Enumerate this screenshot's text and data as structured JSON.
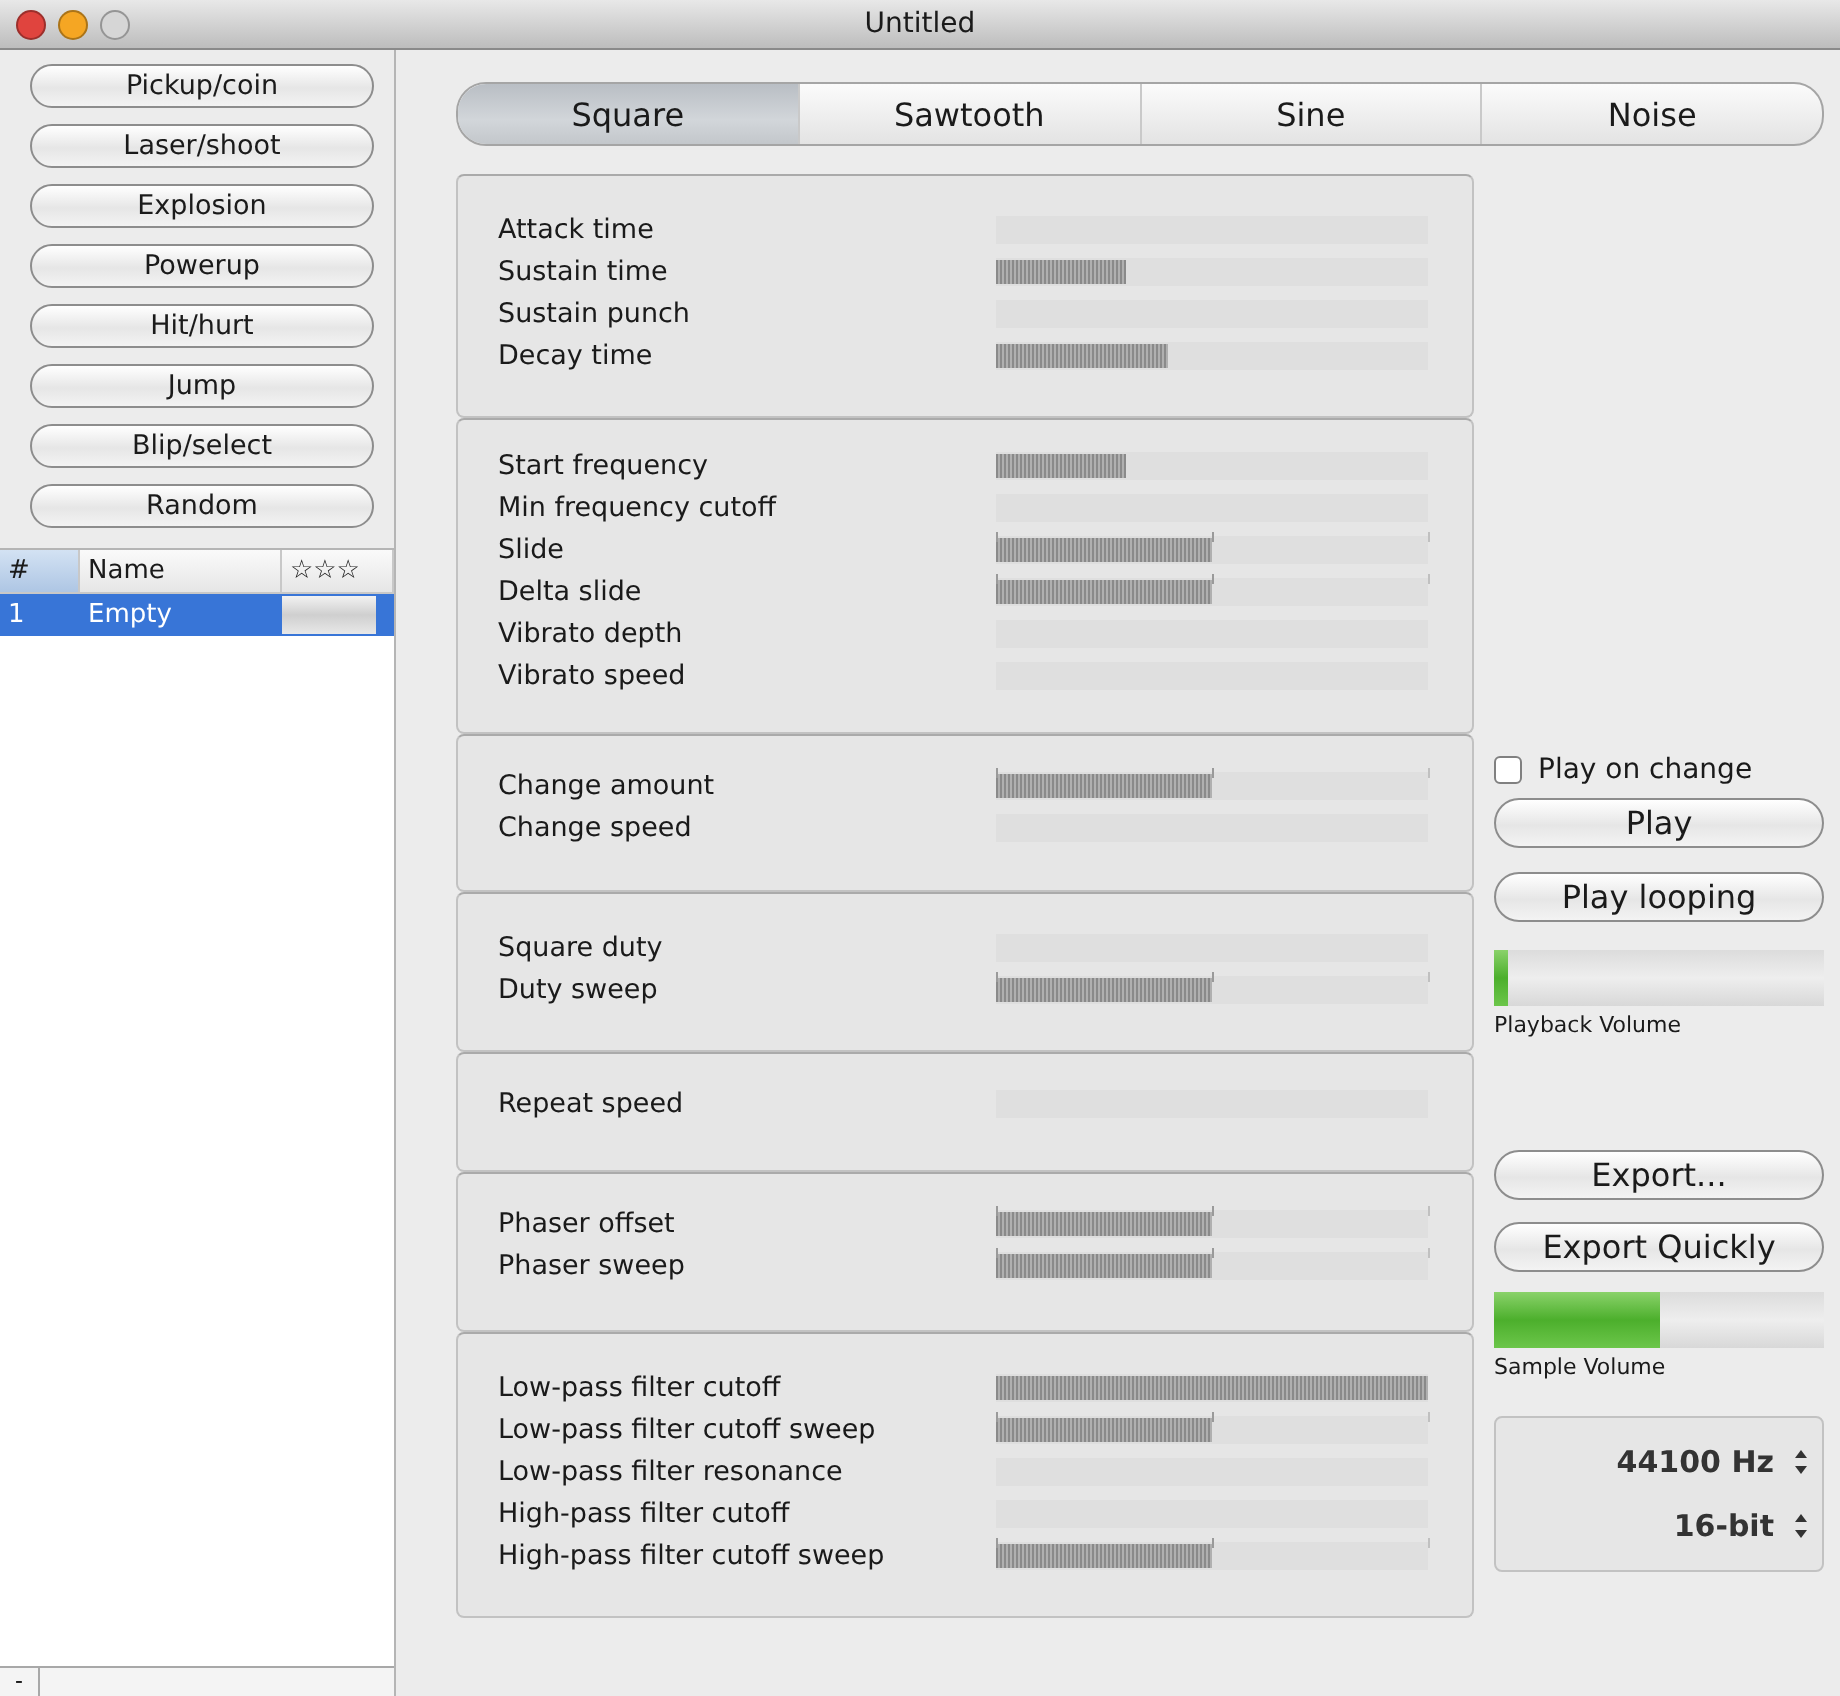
{
  "window": {
    "title": "Untitled"
  },
  "presets": [
    "Pickup/coin",
    "Laser/shoot",
    "Explosion",
    "Powerup",
    "Hit/hurt",
    "Jump",
    "Blip/select",
    "Random"
  ],
  "sound_list": {
    "columns": [
      {
        "label": "#",
        "sorted": true
      },
      {
        "label": "Name",
        "sorted": false
      },
      {
        "label": "☆☆☆",
        "sorted": false
      }
    ],
    "rows": [
      {
        "number": "1",
        "name": "Empty",
        "selected": true
      }
    ]
  },
  "remove_button": "-",
  "waveforms": [
    {
      "label": "Square",
      "selected": true
    },
    {
      "label": "Sawtooth",
      "selected": false
    },
    {
      "label": "Sine",
      "selected": false
    },
    {
      "label": "Noise",
      "selected": false
    }
  ],
  "groups": [
    {
      "params": [
        {
          "label": "Attack time",
          "kind": "unipolar",
          "level": 0
        },
        {
          "label": "Sustain time",
          "kind": "unipolar",
          "level": 0.3
        },
        {
          "label": "Sustain punch",
          "kind": "unipolar",
          "level": 0
        },
        {
          "label": "Decay time",
          "kind": "unipolar",
          "level": 0.4
        }
      ]
    },
    {
      "params": [
        {
          "label": "Start frequency",
          "kind": "unipolar",
          "level": 0.3
        },
        {
          "label": "Min frequency cutoff",
          "kind": "unipolar",
          "level": 0
        },
        {
          "label": "Slide",
          "kind": "bipolar",
          "level": 0.5
        },
        {
          "label": "Delta slide",
          "kind": "bipolar",
          "level": 0.5
        },
        {
          "label": "Vibrato depth",
          "kind": "unipolar",
          "level": 0
        },
        {
          "label": "Vibrato speed",
          "kind": "unipolar",
          "level": 0
        }
      ]
    },
    {
      "params": [
        {
          "label": "Change amount",
          "kind": "bipolar",
          "level": 0.5
        },
        {
          "label": "Change speed",
          "kind": "unipolar",
          "level": 0
        }
      ]
    },
    {
      "params": [
        {
          "label": "Square duty",
          "kind": "unipolar",
          "level": 0
        },
        {
          "label": "Duty sweep",
          "kind": "bipolar",
          "level": 0.5
        }
      ]
    },
    {
      "params": [
        {
          "label": "Repeat speed",
          "kind": "unipolar",
          "level": 0
        }
      ]
    },
    {
      "params": [
        {
          "label": "Phaser offset",
          "kind": "bipolar",
          "level": 0.5
        },
        {
          "label": "Phaser sweep",
          "kind": "bipolar",
          "level": 0.5
        }
      ]
    },
    {
      "params": [
        {
          "label": "Low-pass filter cutoff",
          "kind": "unipolar",
          "level": 1
        },
        {
          "label": "Low-pass filter cutoff sweep",
          "kind": "bipolar",
          "level": 0.5
        },
        {
          "label": "Low-pass filter resonance",
          "kind": "unipolar",
          "level": 0
        },
        {
          "label": "High-pass filter cutoff",
          "kind": "unipolar",
          "level": 0
        },
        {
          "label": "High-pass filter cutoff sweep",
          "kind": "bipolar",
          "level": 0.5
        }
      ]
    }
  ],
  "play_on_change": {
    "label": "Play on change",
    "checked": false
  },
  "play_button": "Play",
  "play_looping_button": "Play looping",
  "playback_volume": {
    "label": "Playback Volume",
    "level": 0.04
  },
  "export_button": "Export...",
  "export_quickly_button": "Export Quickly",
  "sample_volume": {
    "label": "Sample Volume",
    "level": 0.5
  },
  "sample_rate": "44100 Hz",
  "bit_depth": "16-bit"
}
